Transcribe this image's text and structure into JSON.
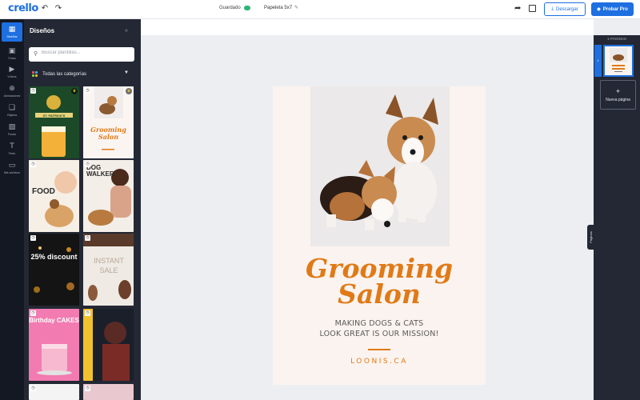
{
  "app": {
    "logo": "crello"
  },
  "header": {
    "saved_label": "Guardado",
    "doc_title": "Papeleta 5x7",
    "download_label": "Descargar",
    "pro_label": "Probar Pro",
    "accent": "#1e6fe0"
  },
  "rail": {
    "items": [
      {
        "label": "Diseños",
        "icon": "designs-icon"
      },
      {
        "label": "Fotos",
        "icon": "photo-icon"
      },
      {
        "label": "Vídeos",
        "icon": "video-icon"
      },
      {
        "label": "Animaciones",
        "icon": "animation-icon"
      },
      {
        "label": "Objetos",
        "icon": "objects-icon"
      },
      {
        "label": "Fondo",
        "icon": "background-icon"
      },
      {
        "label": "Texto",
        "icon": "text-icon"
      },
      {
        "label": "Mis archivos",
        "icon": "folder-icon"
      }
    ]
  },
  "panel": {
    "title": "Diseños",
    "search_placeholder": "Buscar plantillas...",
    "category": "Todas las categorías",
    "thumbs": [
      {
        "text": "ST. PATRICK'S"
      },
      {
        "text": "Grooming Salon"
      },
      {
        "text": "FOOD"
      },
      {
        "text": "DOG WALKER"
      },
      {
        "text": "25% discount"
      },
      {
        "text": "INSTANT SALE"
      },
      {
        "text": "Birthday CAKES"
      },
      {
        "text": ""
      }
    ]
  },
  "canvas": {
    "title": "Grooming Salon",
    "subtitle_line1": "MAKING DOGS & CATS",
    "subtitle_line2": "LOOK GREAT IS OUR MISSION!",
    "footer": "LOONIS.CA",
    "accent": "#e07a17"
  },
  "pages": {
    "header": "1 PÁGINAS",
    "thumb_num": "1",
    "new_page": "Nueva página",
    "tab_label": "Páginas"
  }
}
